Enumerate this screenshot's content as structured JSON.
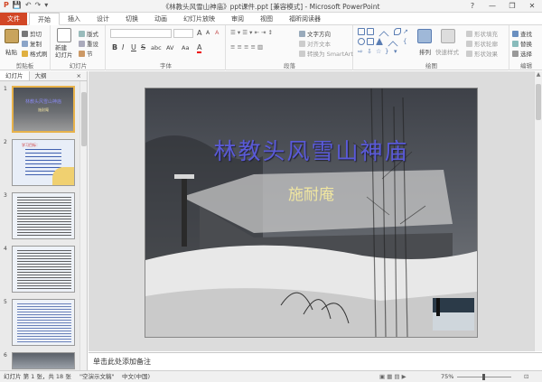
{
  "window": {
    "title": "《林教头风雪山神庙》ppt课件.ppt [兼容模式] - Microsoft PowerPoint",
    "controls": [
      "?",
      "—",
      "❐",
      "✕"
    ]
  },
  "quick_access": [
    "P",
    "💾",
    "↶",
    "↷",
    "▾"
  ],
  "tabs": [
    "文件",
    "开始",
    "插入",
    "设计",
    "切换",
    "动画",
    "幻灯片放映",
    "审阅",
    "视图",
    "福昕阅读器"
  ],
  "ribbon": {
    "clipboard": {
      "label": "剪贴板",
      "paste": "粘贴",
      "cut": "剪切",
      "copy": "复制",
      "format_painter": "格式刷"
    },
    "slides": {
      "label": "幻灯片",
      "new_slide": "新建\n幻灯片",
      "layout": "版式",
      "reset": "重设",
      "section": "节"
    },
    "font": {
      "label": "字体",
      "bold": "B",
      "italic": "I",
      "underline": "U",
      "strike": "S",
      "shadow": "abc",
      "spacing": "AV",
      "case": "Aa",
      "grow": "A",
      "shrink": "A",
      "clear": "A",
      "color": "A"
    },
    "paragraph": {
      "label": "段落",
      "text_direction": "文字方向",
      "align_text": "对齐文本",
      "smartart": "转换为 SmartArt"
    },
    "drawing": {
      "label": "绘图",
      "arrange": "排列",
      "quick_styles": "快速样式",
      "fill": "形状填充",
      "outline": "形状轮廓",
      "effects": "形状效果"
    },
    "editing": {
      "label": "编辑",
      "find": "查找",
      "replace": "替换",
      "select": "选择"
    }
  },
  "left_panel": {
    "tab_slides": "幻灯片",
    "tab_outline": "大纲",
    "close": "×",
    "thumbnails": [
      {
        "num": "1",
        "title": "林教头风雪山神庙",
        "subtitle": "施耐庵"
      },
      {
        "num": "2",
        "title": "学习目标："
      },
      {
        "num": "3",
        "title": ""
      },
      {
        "num": "4",
        "title": ""
      },
      {
        "num": "5",
        "title": ""
      },
      {
        "num": "6",
        "title": ""
      }
    ]
  },
  "slide": {
    "title": "林教头风雪山神庙",
    "author": "施耐庵"
  },
  "notes": {
    "placeholder": "单击此处添加备注"
  },
  "status": {
    "slide_info": "幻灯片 第 1 张，共 18 张",
    "theme": "\"空演示文稿\"",
    "language": "中文(中国)",
    "zoom": "75%"
  },
  "colors": {
    "file_tab": "#d24726",
    "slide_title": "#5a5ad8",
    "slide_author": "#f0e6a0",
    "selected_thumb": "#e8b24a"
  }
}
